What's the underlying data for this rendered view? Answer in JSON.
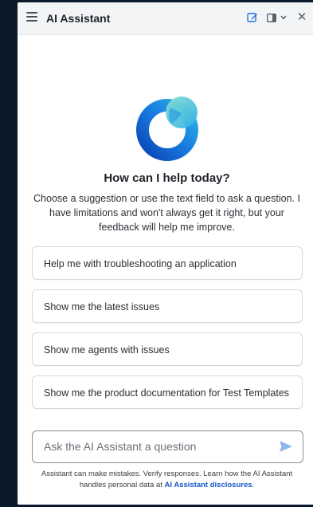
{
  "header": {
    "title": "AI Assistant",
    "icons": [
      "menu-icon",
      "edit-icon",
      "panel-layout-icon",
      "chevron-down-icon",
      "close-icon"
    ],
    "close_glyph": "✕"
  },
  "welcome": {
    "heading": "How can I help today?",
    "intro": "Choose a suggestion or use the text field to ask a question. I have limitations and won't always get it right, but your feedback will help me improve."
  },
  "suggestions": [
    {
      "label": "Help me with troubleshooting an application"
    },
    {
      "label": "Show me the latest issues"
    },
    {
      "label": "Show me agents with issues"
    },
    {
      "label": "Show me the product documentation for Test Templates"
    }
  ],
  "composer": {
    "placeholder": "Ask the AI Assistant a question",
    "value": ""
  },
  "footer": {
    "disclaimer_text": "Assistant can make mistakes. Verify responses. Learn how the AI Assistant handles personal data at ",
    "disclosures_link": "AI Assistant disclosures",
    "disclaimer_end": "."
  },
  "colors": {
    "accent": "#1e6fe6",
    "logo_dark": "#0a52c7",
    "logo_light": "#25b7e8",
    "logo_teal": "#6fd3c6",
    "background": "#0b1a2b",
    "link": "#1457c8"
  }
}
